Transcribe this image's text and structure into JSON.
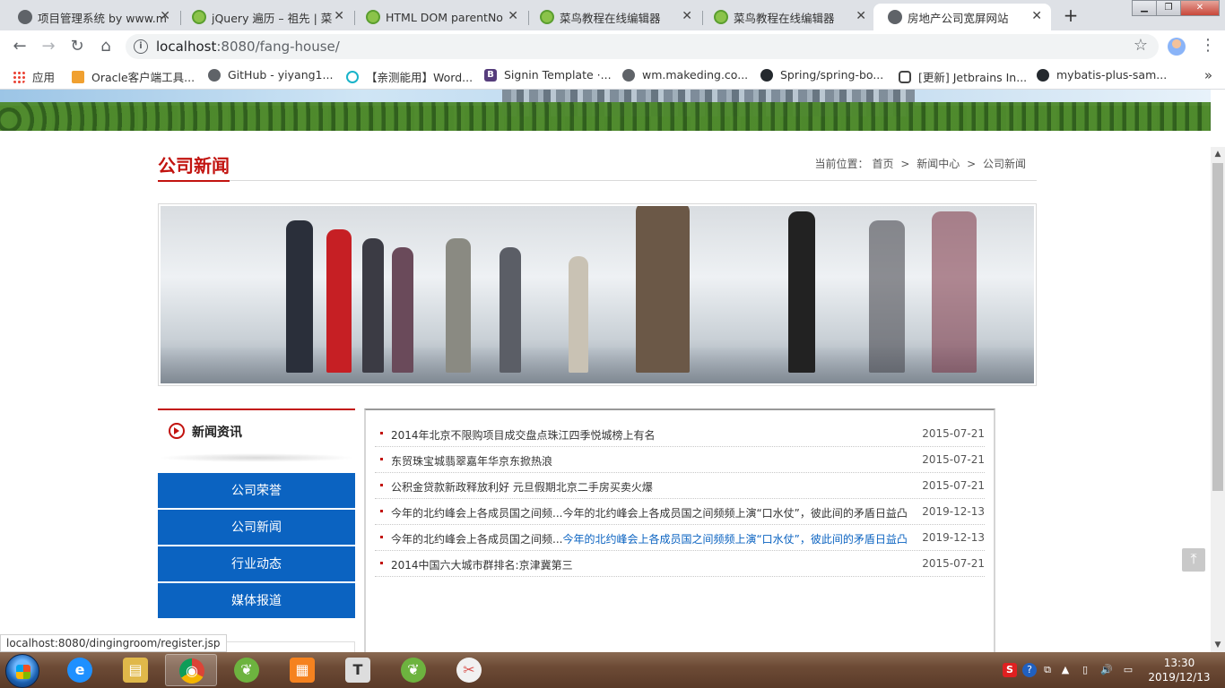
{
  "browser": {
    "tabs": [
      {
        "title": "项目管理系统 by www.m",
        "favicon": "globe-icon",
        "active": false
      },
      {
        "title": "jQuery 遍历 – 祖先 | 菜",
        "favicon": "runoob-icon",
        "active": false
      },
      {
        "title": "HTML DOM parentNo",
        "favicon": "runoob-icon",
        "active": false
      },
      {
        "title": "菜鸟教程在线编辑器",
        "favicon": "runoob-icon",
        "active": false
      },
      {
        "title": "菜鸟教程在线编辑器",
        "favicon": "runoob-icon",
        "active": false
      },
      {
        "title": "房地产公司宽屏网站",
        "favicon": "globe-icon",
        "active": true
      }
    ],
    "close_glyph": "✕",
    "new_tab_glyph": "+",
    "address": {
      "host": "localhost",
      "path": ":8080/fang-house/"
    },
    "bookmarks": [
      {
        "label": "应用",
        "icon": "apps-icon",
        "color": "#ea4335"
      },
      {
        "label": "Oracle客户端工具...",
        "icon": "oracle-icon",
        "color": "#f0a030"
      },
      {
        "label": "GitHub - yiyang1...",
        "icon": "globe-icon",
        "color": "#5f6368"
      },
      {
        "label": "【亲测能用】Word...",
        "icon": "play-icon",
        "color": "#19b3c9"
      },
      {
        "label": "Signin Template ·...",
        "icon": "bootstrap-icon",
        "color": "#563d7c"
      },
      {
        "label": "wm.makeding.co...",
        "icon": "globe-icon",
        "color": "#5f6368"
      },
      {
        "label": "Spring/spring-bo...",
        "icon": "github-icon",
        "color": "#24292e"
      },
      {
        "label": "[更新] Jetbrains In...",
        "icon": "jetbrains-icon",
        "color": "#444444"
      },
      {
        "label": "mybatis-plus-sam...",
        "icon": "github-icon",
        "color": "#24292e"
      }
    ],
    "more_bookmarks": "»"
  },
  "page": {
    "section_title": "公司新闻",
    "breadcrumb": {
      "prefix": "当前位置：",
      "home": "首页",
      "sep": ">",
      "level1": "新闻中心",
      "level2": "公司新闻"
    },
    "sidebar": {
      "title": "新闻资讯",
      "links": [
        "公司荣誉",
        "公司新闻",
        "行业动态",
        "媒体报道"
      ]
    },
    "news": [
      {
        "title": "2014年北京不限购项目成交盘点珠江四季悦城榜上有名",
        "highlight": "",
        "date": "2015-07-21"
      },
      {
        "title": "东贸珠宝城翡翠嘉年华京东掀热浪",
        "highlight": "",
        "date": "2015-07-21"
      },
      {
        "title": "公积金贷款新政释放利好 元旦假期北京二手房买卖火爆",
        "highlight": "",
        "date": "2015-07-21"
      },
      {
        "title": "今年的北约峰会上各成员国之间频...今年的北约峰会上各成员国之间频频上演“口水仗”，彼此间的矛盾日益凸",
        "highlight": "",
        "date": "2019-12-13"
      },
      {
        "title": "今年的北约峰会上各成员国之间频...",
        "highlight": "今年的北约峰会上各成员国之间频频上演“口水仗”，彼此间的矛盾日益凸",
        "date": "2019-12-13"
      },
      {
        "title": "2014中国六大城市群排名:京津冀第三",
        "highlight": "",
        "date": "2015-07-21"
      }
    ],
    "status_url": "localhost:8080/dingingroom/register.jsp",
    "back_to_top": "⤒"
  },
  "taskbar": {
    "apps": [
      {
        "name": "ie-icon",
        "glyph": "e",
        "color": "#1e90ff",
        "active": false
      },
      {
        "name": "explorer-icon",
        "glyph": "▤",
        "color": "#e0b84a",
        "active": false
      },
      {
        "name": "chrome-icon",
        "glyph": "◉",
        "color": "#db4437",
        "active": true
      },
      {
        "name": "spring-tool-icon",
        "glyph": "❦",
        "color": "#6db33f",
        "active": false
      },
      {
        "name": "office-icon",
        "glyph": "▦",
        "color": "#f5821f",
        "active": false
      },
      {
        "name": "typora-icon",
        "glyph": "T",
        "color": "#dddddd",
        "active": false
      },
      {
        "name": "spring-icon",
        "glyph": "❦",
        "color": "#6db33f",
        "active": false
      },
      {
        "name": "snipping-icon",
        "glyph": "✂",
        "color": "#d9534f",
        "active": false
      }
    ],
    "clock": {
      "time": "13:30",
      "date": "2019/12/13"
    }
  },
  "colors": {
    "brand_red": "#c2130f",
    "nav_blue": "#0b63c1"
  }
}
